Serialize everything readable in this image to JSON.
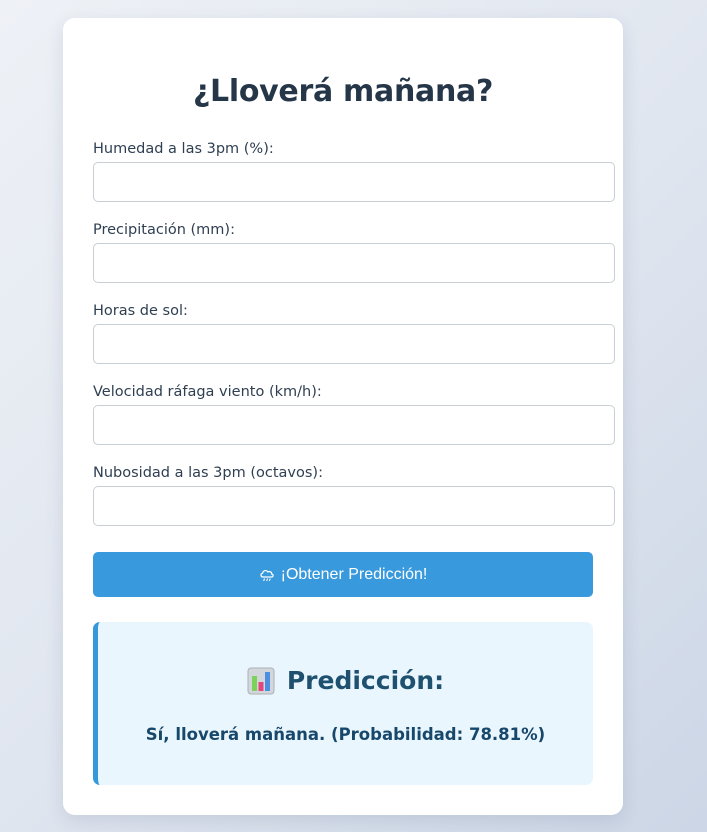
{
  "form": {
    "title": "¿Lloverá mañana?",
    "fields": [
      {
        "label": "Humedad a las 3pm (%):",
        "value": "",
        "placeholder": ""
      },
      {
        "label": "Precipitación (mm):",
        "value": "",
        "placeholder": ""
      },
      {
        "label": "Horas de sol:",
        "value": "",
        "placeholder": ""
      },
      {
        "label": "Velocidad ráfaga viento (km/h):",
        "value": "",
        "placeholder": ""
      },
      {
        "label": "Nubosidad a las 3pm (octavos):",
        "value": "",
        "placeholder": ""
      }
    ],
    "submit": {
      "label": "¡Obtener Predicción!",
      "icon": "rain-cloud-icon"
    }
  },
  "result": {
    "icon": "bar-chart-icon",
    "title": "Predicción:",
    "text": "Sí, lloverá mañana. (Probabilidad: 78.81%)"
  },
  "colors": {
    "accent": "#3899dc",
    "result_background": "#eaf6fd",
    "result_border": "#3498db",
    "title_text": "#253648",
    "result_text": "#17476a"
  }
}
